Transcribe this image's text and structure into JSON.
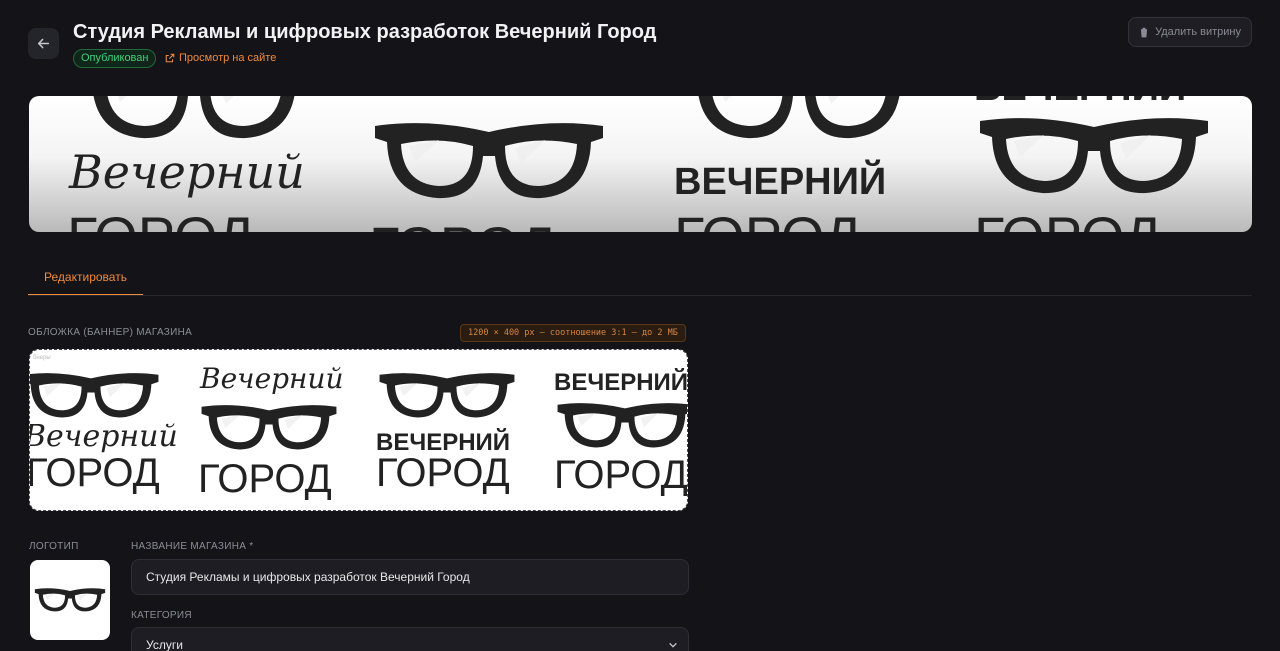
{
  "header": {
    "title": "Студия Рекламы и цифровых разработок Вечерний Город",
    "status": "Опубликован",
    "view_link": "Просмотр на сайте",
    "delete_label": "Удалить витрину"
  },
  "brand": {
    "script_word": "Вечерний",
    "bold_word": "ВЕЧЕРНИЙ",
    "city_word": "ГОРОД"
  },
  "tabs": [
    {
      "label": "Редактировать",
      "active": true
    }
  ],
  "form": {
    "cover_label": "Обложка (баннер) магазина",
    "cover_hint": "1200 × 400 px — соотношение 3:1 — до 2 МБ",
    "cover_corner_text": "бнеры",
    "logo_label": "Логотип",
    "name_label": "Название магазина *",
    "name_value": "Студия Рекламы и цифровых разработок Вечерний Город",
    "category_label": "Категория",
    "category_value": "Услуги"
  },
  "colors": {
    "background": "#131318",
    "accent": "#f08a3c",
    "success": "#3ed07a"
  },
  "icons": [
    "arrow-left-icon",
    "external-link-icon",
    "trash-icon",
    "chevron-down-icon",
    "glasses-icon"
  ]
}
